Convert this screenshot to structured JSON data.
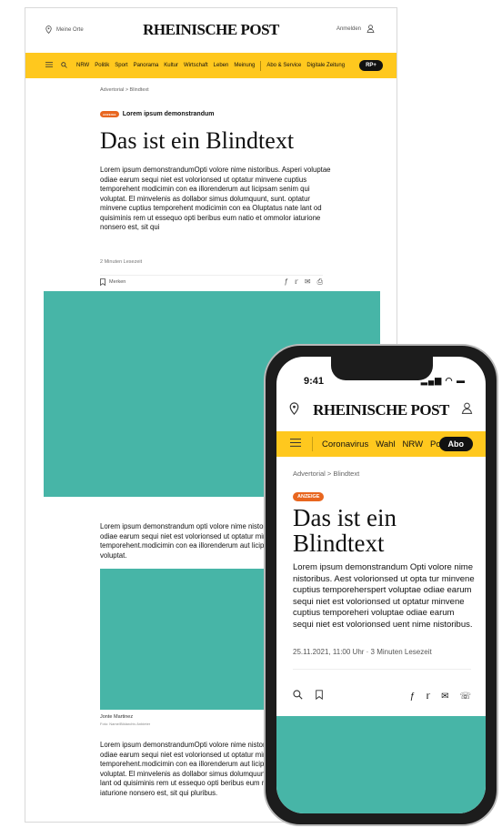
{
  "desktop": {
    "location": "Meine Orte",
    "logo": "RHEINISCHE POST",
    "login": "Anmelden",
    "nav": [
      "NRW",
      "Politik",
      "Sport",
      "Panorama",
      "Kultur",
      "Wirtschaft",
      "Leben",
      "Meinung"
    ],
    "nav_service": [
      "Abo & Service",
      "Digitale Zeitung"
    ],
    "rp_plus": "RP+",
    "breadcrumb": "Advertorial  >  Blindtext",
    "badge": "ANZEIGE",
    "kicker": "Lorem ipsum demonstrandum",
    "title": "Das ist ein Blindtext",
    "lead": "Lorem ipsum demonstrandumOpti volore nime nistoribus. Asperi voluptae odiae earum sequi niet est volorionsed ut optatur minvene cuptius temporehent modicimin con ea illorenderum aut licipsam senim qui voluptat. El minvelenis as dollabor simus dolumquunt, sunt. optatur minvene cuptius temporehent modicimin con ea Oluptatus nate lant od quisiminis rem ut essequo opti beribus eum natio et ommolor iaturione nonsero est, sit qui",
    "read_time": "2 Minuten Lesezeit",
    "bookmark": "Merken",
    "body1": "Lorem ipsum demonstrandum opti volore nime nistoribus. Asperi voluptae odiae earum sequi niet est volorionsed ut optatur minvene cuptius temporehent.modicimin con ea illorenderum aut licipsam senim qui voluptat.",
    "caption": "Jonte Martinez",
    "caption_credit": "Foto: Name/Bildarchiv Anbieter",
    "body2": "Lorem ipsum demonstrandumOpti volore nime nistoribus. Asperi voluptae odiae earum sequi niet est volorionsed ut optatur minvene cuptius temporehent.modicimin con ea illorenderum aut licipsam senim qui voluptat. El minvelenis as dollabor simus dolumquunt, sunt. Oluptatus nate lant od quisiminis rem ut essequo opti beribus eum natio et ommolor iaturione nonsero est, sit qui pluribus."
  },
  "phone": {
    "time": "9:41",
    "status": "▂▄▆ ◠ ▬",
    "logo": "RHEINISCHE POST",
    "nav": [
      "Coronavirus",
      "Wahl",
      "NRW",
      "Po"
    ],
    "abo": "Abo",
    "breadcrumb": "Advertorial  >  Blindtext",
    "badge": "ANZEIGE",
    "title": "Das ist ein Blindtext",
    "lead": "Lorem ipsum demonstrandum Opti volore nime nistoribus. Aest volorionsed ut opta tur minvene cuptius temporeherspert voluptae odiae earum sequi niet est volorionsed ut optatur minvene cuptius temporeheri voluptae odiae earum sequi niet est volorionsed uent nime nistoribus.",
    "meta": "25.11.2021, 11:00 Uhr  ·  3 Minuten Lesezeit"
  },
  "icons": {
    "pin": "location-pin-icon",
    "user": "user-icon",
    "menu": "hamburger-menu-icon",
    "search": "search-icon",
    "bookmark": "bookmark-icon",
    "facebook": "facebook-icon",
    "twitter": "twitter-icon",
    "mail": "mail-icon",
    "print": "print-icon",
    "whatsapp": "whatsapp-icon"
  },
  "colors": {
    "brand_yellow": "#ffc81e",
    "badge_orange": "#e8661f",
    "placeholder_teal": "#47b5a7",
    "dark": "#111111"
  }
}
